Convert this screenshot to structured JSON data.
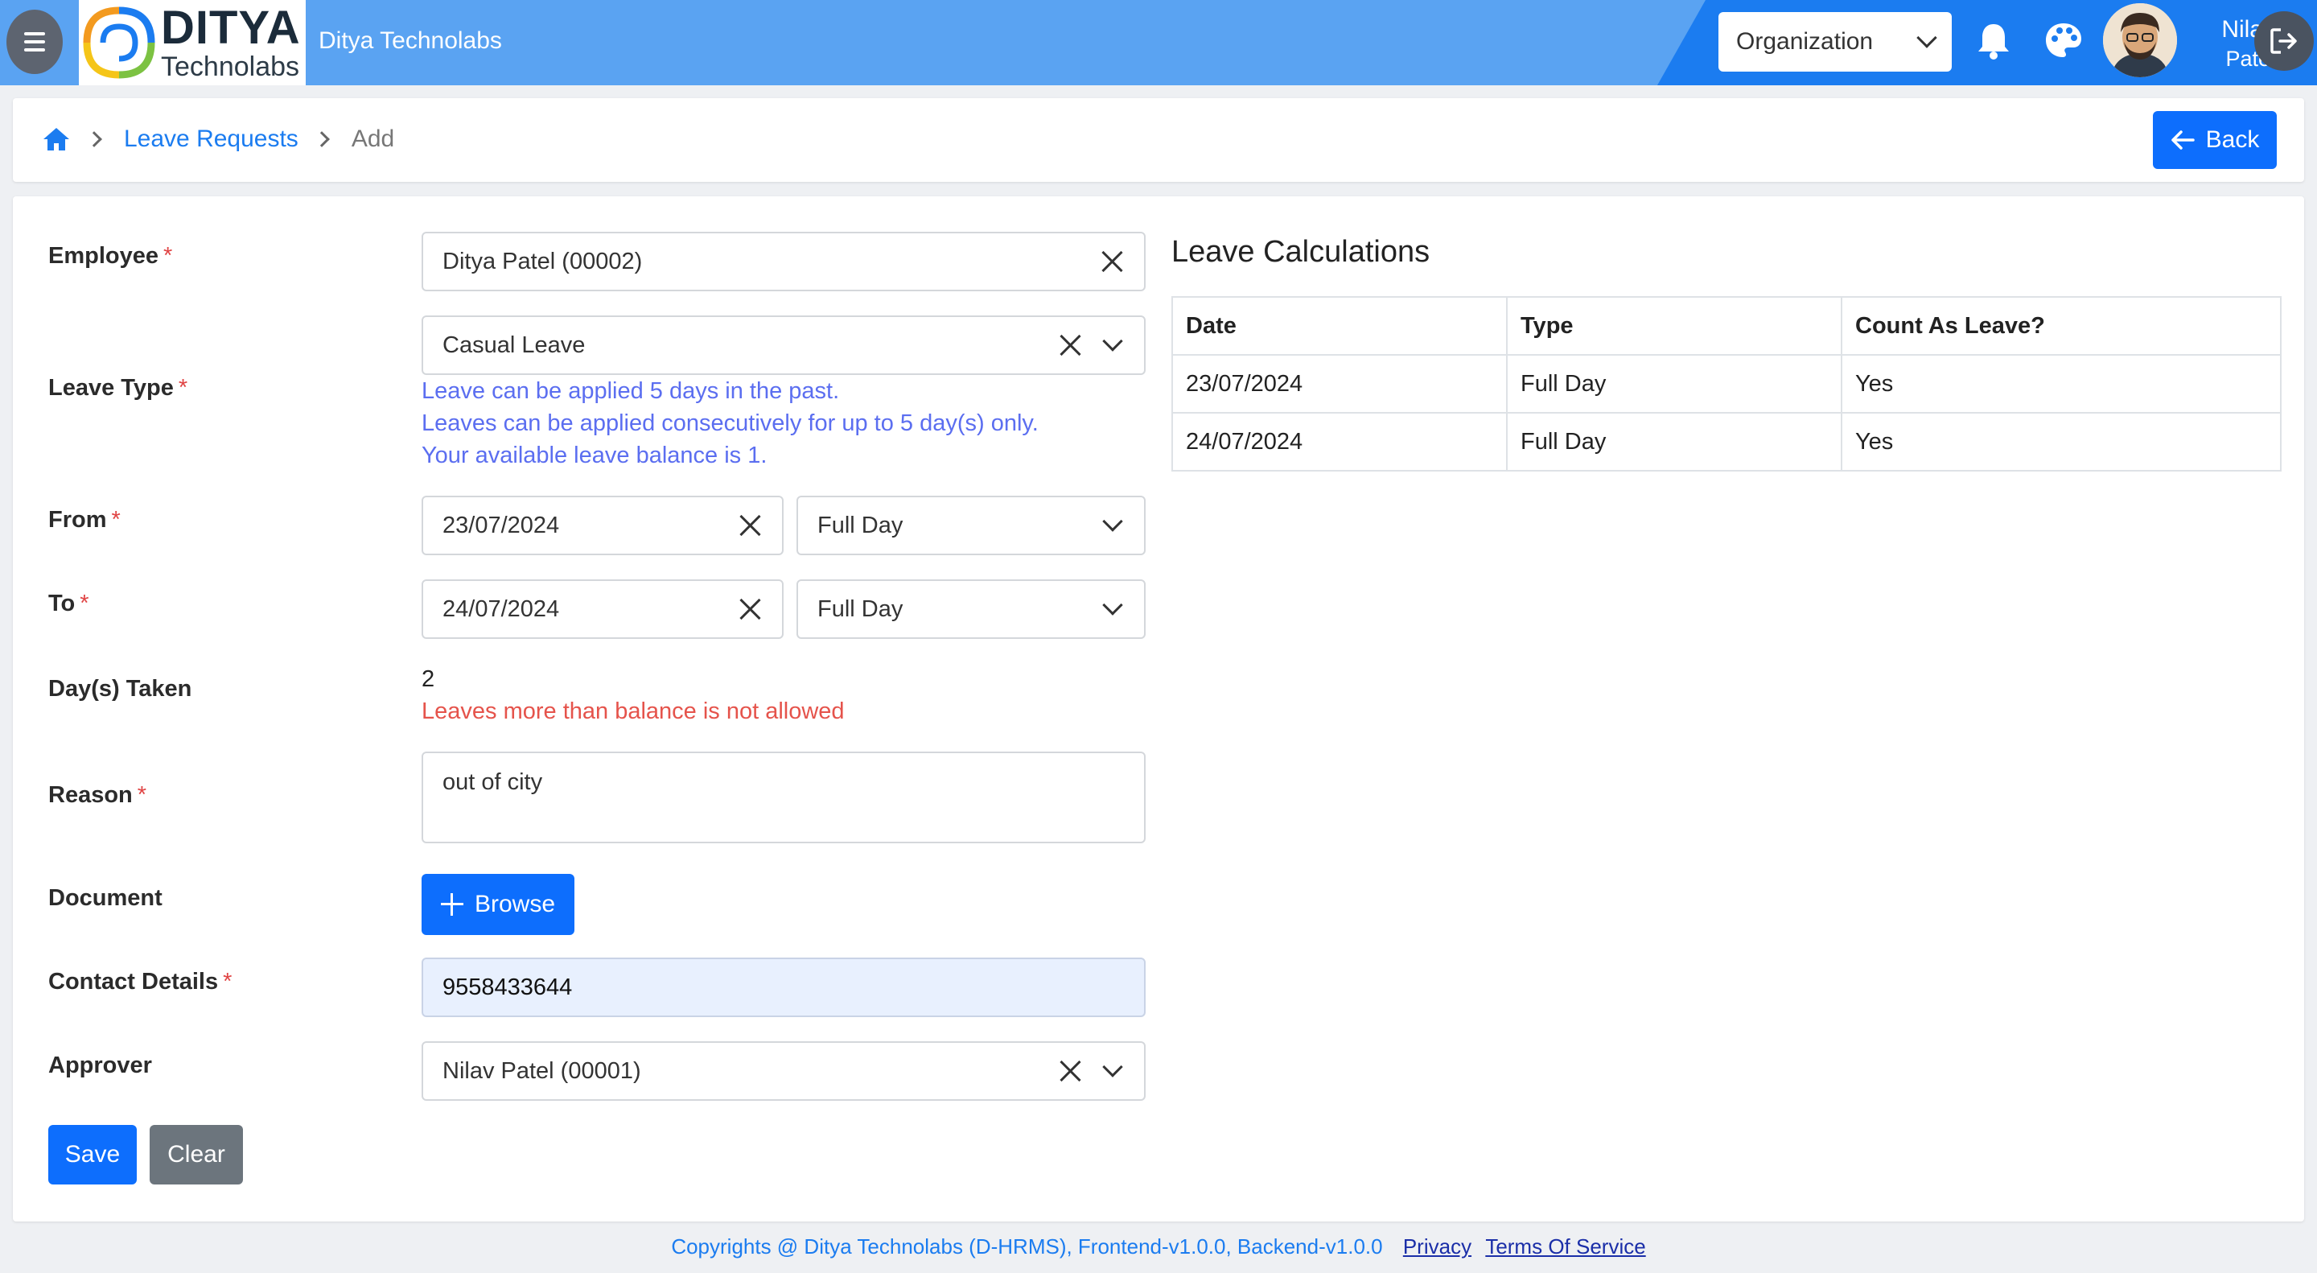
{
  "header": {
    "logo_title": "DITYA",
    "logo_subtitle": "Technolabs",
    "app_name": "Ditya Technolabs",
    "org_select": "Organization",
    "user_first": "Nilav",
    "user_last": "Patel"
  },
  "breadcrumb": {
    "parent": "Leave Requests",
    "current": "Add",
    "back_label": "Back"
  },
  "form": {
    "employee_label": "Employee",
    "employee_value": "Ditya Patel (00002)",
    "leave_type_label": "Leave Type",
    "leave_type_value": "Casual Leave",
    "hint1": "Leave can be applied 5 days in the past.",
    "hint2": "Leaves can be applied consecutively for up to 5 day(s) only.",
    "hint3": "Your available leave balance is 1.",
    "from_label": "From",
    "from_date": "23/07/2024",
    "from_part": "Full Day",
    "to_label": "To",
    "to_date": "24/07/2024",
    "to_part": "Full Day",
    "days_label": "Day(s) Taken",
    "days_value": "2",
    "days_error": "Leaves more than balance is not allowed",
    "reason_label": "Reason",
    "reason_value": "out of city",
    "document_label": "Document",
    "browse_label": "Browse",
    "contact_label": "Contact Details",
    "contact_value": "9558433644",
    "approver_label": "Approver",
    "approver_value": "Nilav Patel (00001)",
    "required_mark": "*",
    "save_label": "Save",
    "clear_label": "Clear"
  },
  "calc": {
    "title": "Leave Calculations",
    "headers": [
      "Date",
      "Type",
      "Count As Leave?"
    ],
    "rows": [
      [
        "23/07/2024",
        "Full Day",
        "Yes"
      ],
      [
        "24/07/2024",
        "Full Day",
        "Yes"
      ]
    ]
  },
  "footer": {
    "copyright": "Copyrights @ Ditya Technolabs (D-HRMS), Frontend-v1.0.0, Backend-v1.0.0",
    "privacy": "Privacy",
    "terms": "Terms Of Service"
  },
  "colors": {
    "header": "#5aa3f2",
    "header_dark": "#1b7cf0",
    "primary": "#0d6efd",
    "hint": "#5b6ef0",
    "error": "#e5534b"
  }
}
